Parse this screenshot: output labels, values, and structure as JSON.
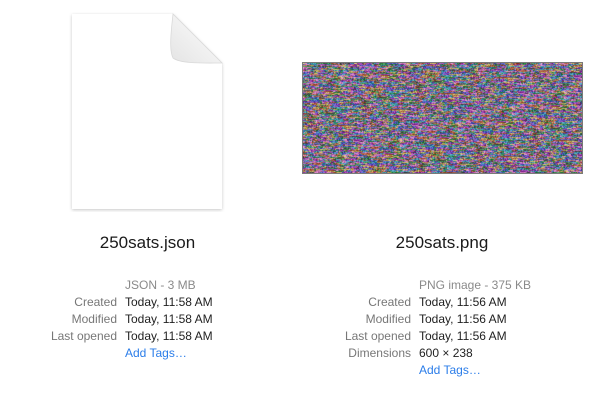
{
  "left": {
    "file_name": "250sats.json",
    "icon": "document-icon",
    "kind": "JSON - 3 MB",
    "rows": [
      {
        "label": "Created",
        "value": "Today, 11:58 AM"
      },
      {
        "label": "Modified",
        "value": "Today, 11:58 AM"
      },
      {
        "label": "Last opened",
        "value": "Today, 11:58 AM"
      }
    ],
    "add_tags": "Add Tags…"
  },
  "right": {
    "file_name": "250sats.png",
    "thumbnail": "noise-image-thumbnail",
    "kind": "PNG image - 375 KB",
    "rows": [
      {
        "label": "Created",
        "value": "Today, 11:56 AM"
      },
      {
        "label": "Modified",
        "value": "Today, 11:56 AM"
      },
      {
        "label": "Last opened",
        "value": "Today, 11:56 AM"
      },
      {
        "label": "Dimensions",
        "value": "600 × 238"
      }
    ],
    "add_tags": "Add Tags…"
  },
  "colors": {
    "label_gray": "#777777",
    "link_blue": "#2b7de9"
  }
}
